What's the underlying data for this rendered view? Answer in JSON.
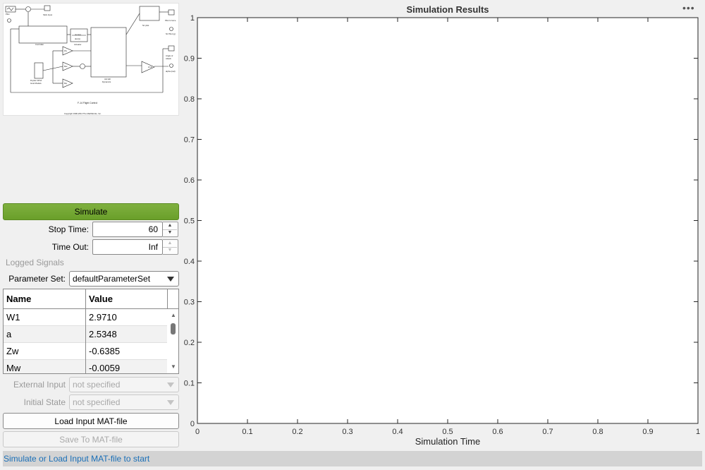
{
  "diagram": {
    "title": "F-14 Flight Control",
    "copyright": "Copyright 1990-2014 The MathWorks, Inc."
  },
  "simulate_label": "Simulate",
  "stop_time": {
    "label": "Stop Time:",
    "value": "60"
  },
  "time_out": {
    "label": "Time Out:",
    "value": "Inf"
  },
  "logged_signals_label": "Logged Signals",
  "parameter_set": {
    "label": "Parameter Set:",
    "value": "defaultParameterSet"
  },
  "param_table": {
    "columns": [
      "Name",
      "Value"
    ],
    "rows": [
      {
        "name": "W1",
        "value": "2.9710"
      },
      {
        "name": "a",
        "value": "2.5348"
      },
      {
        "name": "Zw",
        "value": "-0.6385"
      },
      {
        "name": "Mw",
        "value": "-0.0059"
      }
    ]
  },
  "external_input": {
    "label": "External Input",
    "value": "not specified"
  },
  "initial_state": {
    "label": "Initial State",
    "value": "not specified"
  },
  "load_button": "Load Input MAT-file",
  "save_button": "Save To MAT-file",
  "status": "Simulate or Load Input MAT-file to start",
  "menu_icon": "more-options-icon",
  "chart_data": {
    "type": "line",
    "title": "Simulation Results",
    "xlabel": "Simulation Time",
    "ylabel": "",
    "xlim": [
      0,
      1
    ],
    "ylim": [
      0,
      1
    ],
    "xticks": [
      "0",
      "0.1",
      "0.2",
      "0.3",
      "0.4",
      "0.5",
      "0.6",
      "0.7",
      "0.8",
      "0.9",
      "1"
    ],
    "yticks": [
      "0",
      "0.1",
      "0.2",
      "0.3",
      "0.4",
      "0.5",
      "0.6",
      "0.7",
      "0.8",
      "0.9",
      "1"
    ],
    "series": [],
    "grid": false
  }
}
